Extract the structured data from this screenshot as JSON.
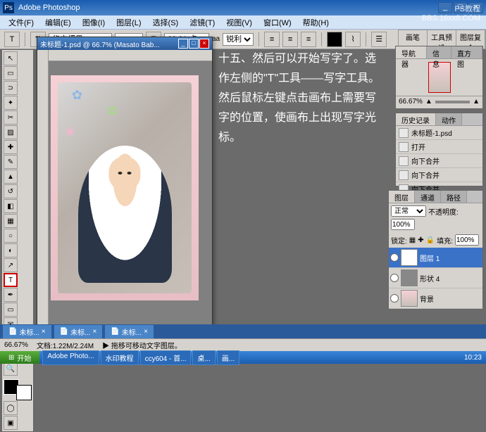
{
  "app": {
    "title": "Adobe Photoshop"
  },
  "menu": [
    "文件(F)",
    "编辑(E)",
    "图像(I)",
    "图层(L)",
    "选择(S)",
    "滤镜(T)",
    "视图(V)",
    "窗口(W)",
    "帮助(H)"
  ],
  "options": {
    "font_family": "华文细黑",
    "font_style": "-",
    "font_size": "28.31 点",
    "aa": "锐利"
  },
  "doc": {
    "title": "未标题-1.psd @ 66.7% (Masato Bab..."
  },
  "instruction": "十五、然后可以开始写字了。选作左侧的\"T\"工具——写字工具。然后鼠标左键点击画布上需要写字的位置，使画布上出现写字光标。",
  "nav": {
    "tabs": [
      "导航器",
      "信息",
      "直方图"
    ],
    "zoom": "66.67%"
  },
  "history": {
    "tabs": [
      "历史记录",
      "动作"
    ],
    "doc": "未标题-1.psd",
    "items": [
      "打开",
      "向下合并",
      "向下合并",
      "向下合并"
    ]
  },
  "layers": {
    "tabs": [
      "图层",
      "通道",
      "路径"
    ],
    "mode": "正常",
    "opacity_label": "不透明度:",
    "opacity": "100%",
    "lock_label": "锁定:",
    "fill_label": "填充:",
    "fill": "100%",
    "items": [
      {
        "name": "图层 1",
        "type": "T",
        "active": true
      },
      {
        "name": "形状 4",
        "type": "shape"
      },
      {
        "name": "背景",
        "type": "bg"
      }
    ]
  },
  "preset_tabs": [
    "画笔",
    "工具预设",
    "图层复合"
  ],
  "doc_tabs": [
    "未标...",
    "未标...",
    "未标..."
  ],
  "status": {
    "zoom": "66.67%",
    "size": "文档:1.22M/2.24M",
    "hint": "拖移可移动文字图层。"
  },
  "taskbar": {
    "start": "开始",
    "tasks": [
      "Adobe Photo...",
      "水印教程",
      "ccy604 - 首...",
      "桌...",
      "画..."
    ],
    "time": "10:23"
  },
  "watermark": {
    "l1": "PS教程",
    "l2": "BBS.16xx8.COM"
  }
}
